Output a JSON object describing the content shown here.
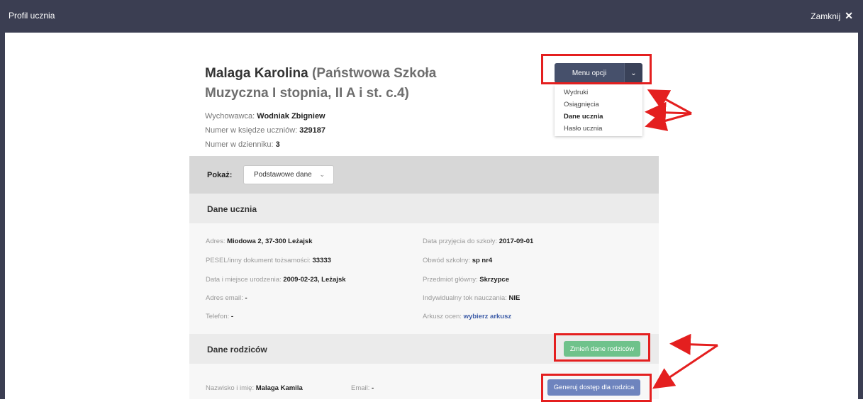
{
  "window": {
    "title": "Profil ucznia",
    "close_label": "Zamknij",
    "close_glyph": "✕"
  },
  "student": {
    "name": "Malaga Karolina",
    "school_line1": "(Państwowa Szkoła",
    "school_line2": "Muzyczna I stopnia, II A i st. c.4)",
    "tutor_label": "Wychowawca:",
    "tutor_value": "Wodniak Zbigniew",
    "register_label": "Numer w księdze uczniów:",
    "register_value": "329187",
    "journal_label": "Numer w dzienniku:",
    "journal_value": "3"
  },
  "menu": {
    "button_label": "Menu opcji",
    "caret_glyph": "⌄",
    "items": [
      "Wydruki",
      "Osiągnięcia",
      "Dane ucznia",
      "Hasło ucznia"
    ]
  },
  "filter": {
    "label": "Pokaż:",
    "selected": "Podstawowe dane",
    "caret_glyph": "⌄"
  },
  "student_data": {
    "heading": "Dane ucznia",
    "left": [
      {
        "label": "Adres:",
        "value": "Miodowa 2, 37-300 Leżajsk"
      },
      {
        "label": "PESEL/inny dokument tożsamości:",
        "value": "33333"
      },
      {
        "label": "Data i miejsce urodzenia:",
        "value": "2009-02-23, Leżajsk"
      },
      {
        "label": "Adres email:",
        "value": "-"
      },
      {
        "label": "Telefon:",
        "value": "-"
      }
    ],
    "right": [
      {
        "label": "Data przyjęcia do szkoły:",
        "value": "2017-09-01"
      },
      {
        "label": "Obwód szkolny:",
        "value": "sp nr4"
      },
      {
        "label": "Przedmiot główny:",
        "value": "Skrzypce"
      },
      {
        "label": "Indywidualny tok nauczania:",
        "value": "NIE"
      },
      {
        "label": "Arkusz ocen:",
        "value": "wybierz arkusz"
      }
    ]
  },
  "parents": {
    "heading": "Dane rodziców",
    "change_button": "Zmień dane rodziców",
    "access_button": "Generuj dostęp dla rodzica",
    "name_label": "Nazwisko i imię:",
    "name_value": "Malaga Kamila",
    "email_label": "Email:",
    "email_value": "-"
  },
  "colors": {
    "topbar": "#3b3e52",
    "highlight": "#e41f1f",
    "green_button": "#6fc28b",
    "blue_button": "#6e84be",
    "link": "#3f5ea8"
  }
}
